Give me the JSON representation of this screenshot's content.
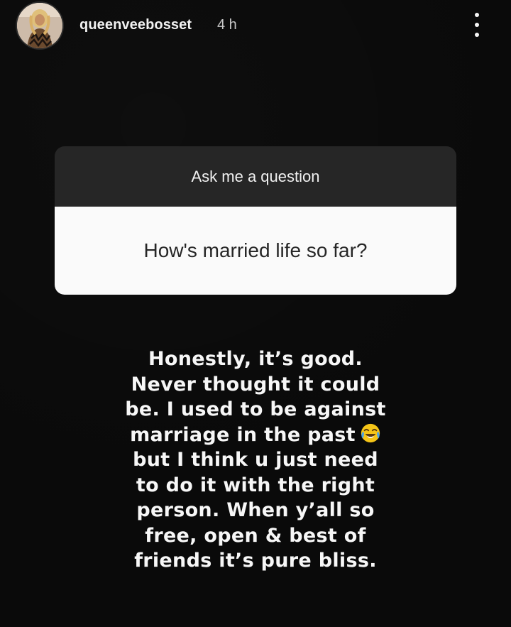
{
  "story": {
    "username": "queenveebosset",
    "time": "4 h",
    "avatar": "profile-avatar-image",
    "more_icon": "more-vertical-icon"
  },
  "question_sticker": {
    "prompt": "Ask me a question",
    "question": "How's married life so far?"
  },
  "answer": {
    "lines": [
      "Honestly, it’s good.",
      "Never thought it could",
      "be. I used to be against",
      "marriage in the past",
      "but I think u just need",
      "to do it with the right",
      "person.  When y’all so",
      "free, open & best of",
      "friends it’s pure bliss."
    ],
    "emoji": "face-with-tears-of-joy-icon"
  },
  "colors": {
    "background": "#0a0a0a",
    "sticker_header": "#262626",
    "sticker_body": "#fafafa",
    "text": "#f7f7f7"
  }
}
